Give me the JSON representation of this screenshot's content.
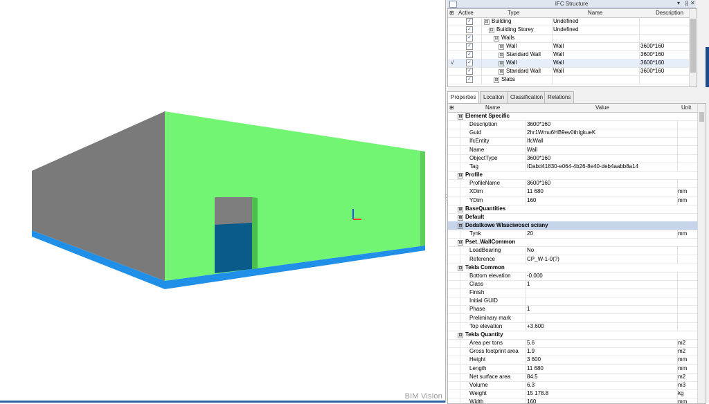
{
  "brand": "BIM Vision",
  "colors": {
    "wall_front": "#72f572",
    "wall_side": "#7a7a7a",
    "slab": "#1f8fe8",
    "door": "#0a5a8a",
    "selection_row": "#c6d4e9",
    "accent": "#1c4b8c"
  },
  "structure": {
    "title": "IFC Structure",
    "controls": [
      "▾",
      "ㅐ",
      "✕"
    ],
    "columns": [
      "Active",
      "Type",
      "Name",
      "Description"
    ],
    "rows": [
      {
        "marker": "",
        "checked": "✓",
        "indent": 0,
        "expander": "⊟",
        "type": "Building",
        "name": "Undefined",
        "desc": ""
      },
      {
        "marker": "",
        "checked": "✓",
        "indent": 1,
        "expander": "⊟",
        "type": "Building Storey",
        "name": "Undefined",
        "desc": ""
      },
      {
        "marker": "",
        "checked": "✓",
        "indent": 2,
        "expander": "⊟",
        "type": "Walls",
        "name": "",
        "desc": ""
      },
      {
        "marker": "",
        "checked": "✓",
        "indent": 3,
        "expander": "⊞",
        "type": "Wall",
        "name": "Wall",
        "desc": "3600*160"
      },
      {
        "marker": "",
        "checked": "✓",
        "indent": 3,
        "expander": "⊞",
        "type": "Standard Wall",
        "name": "Wall",
        "desc": "3600*160"
      },
      {
        "marker": "√",
        "checked": "✓",
        "indent": 3,
        "expander": "⊞",
        "type": "Wall",
        "name": "Wall",
        "desc": "3600*160"
      },
      {
        "marker": "",
        "checked": "✓",
        "indent": 3,
        "expander": "⊞",
        "type": "Standard Wall",
        "name": "Wall",
        "desc": "3600*160"
      },
      {
        "marker": "",
        "checked": "✓",
        "indent": 2,
        "expander": "⊞",
        "type": "Slabs",
        "name": "",
        "desc": ""
      }
    ]
  },
  "tabs": [
    "Properties",
    "Location",
    "Classification",
    "Relations"
  ],
  "properties": {
    "columns": [
      "Name",
      "Value",
      "Unit"
    ],
    "rows": [
      {
        "cat": true,
        "hl": false,
        "exp": "⊟",
        "name": "Element Specific",
        "value": "",
        "unit": ""
      },
      {
        "cat": false,
        "name": "Description",
        "value": "3600*160",
        "unit": ""
      },
      {
        "cat": false,
        "name": "Guid",
        "value": "2hr1Wmu6HB9ev0thIgkueK",
        "unit": ""
      },
      {
        "cat": false,
        "name": "IfcEntity",
        "value": "IfcWall",
        "unit": ""
      },
      {
        "cat": false,
        "name": "Name",
        "value": "Wall",
        "unit": ""
      },
      {
        "cat": false,
        "name": "ObjectType",
        "value": "3600*160",
        "unit": ""
      },
      {
        "cat": false,
        "name": "Tag",
        "value": "IDabd41830-e064-4b26-8e40-deb4aabb8a14",
        "unit": ""
      },
      {
        "cat": true,
        "hl": false,
        "exp": "⊟",
        "name": "Profile",
        "value": "",
        "unit": ""
      },
      {
        "cat": false,
        "name": "ProfileName",
        "value": "3600*160",
        "unit": ""
      },
      {
        "cat": false,
        "name": "XDim",
        "value": "11 680",
        "unit": "mm"
      },
      {
        "cat": false,
        "name": "YDim",
        "value": "160",
        "unit": "mm"
      },
      {
        "cat": true,
        "hl": false,
        "exp": "⊞",
        "name": "BaseQuantities",
        "value": "",
        "unit": ""
      },
      {
        "cat": true,
        "hl": false,
        "exp": "⊞",
        "name": "Default",
        "value": "",
        "unit": ""
      },
      {
        "cat": true,
        "hl": true,
        "exp": "⊟",
        "name": "Dodatkowe Wlasciwosci sciany",
        "value": "",
        "unit": ""
      },
      {
        "cat": false,
        "name": "Tynk",
        "value": "20",
        "unit": "mm"
      },
      {
        "cat": true,
        "hl": false,
        "exp": "⊟",
        "name": "Pset_WallCommon",
        "value": "",
        "unit": ""
      },
      {
        "cat": false,
        "name": "LoadBearing",
        "value": "No",
        "unit": ""
      },
      {
        "cat": false,
        "name": "Reference",
        "value": "CP_W-1-0(?)",
        "unit": ""
      },
      {
        "cat": true,
        "hl": false,
        "exp": "⊟",
        "name": "Tekla Common",
        "value": "",
        "unit": ""
      },
      {
        "cat": false,
        "name": "Bottom elevation",
        "value": "-0.000",
        "unit": ""
      },
      {
        "cat": false,
        "name": "Class",
        "value": "1",
        "unit": ""
      },
      {
        "cat": false,
        "name": "Finish",
        "value": "",
        "unit": ""
      },
      {
        "cat": false,
        "name": "Initial GUID",
        "value": "",
        "unit": ""
      },
      {
        "cat": false,
        "name": "Phase",
        "value": "1",
        "unit": ""
      },
      {
        "cat": false,
        "name": "Preliminary mark",
        "value": "",
        "unit": ""
      },
      {
        "cat": false,
        "name": "Top elevation",
        "value": " +3.600",
        "unit": ""
      },
      {
        "cat": true,
        "hl": false,
        "exp": "⊟",
        "name": "Tekla Quantity",
        "value": "",
        "unit": ""
      },
      {
        "cat": false,
        "name": "Area per tons",
        "value": "5.6",
        "unit": "m2"
      },
      {
        "cat": false,
        "name": "Gross footprint area",
        "value": "1.9",
        "unit": "m2"
      },
      {
        "cat": false,
        "name": "Height",
        "value": "3 600",
        "unit": "mm"
      },
      {
        "cat": false,
        "name": "Length",
        "value": "11 680",
        "unit": "mm"
      },
      {
        "cat": false,
        "name": "Net surface area",
        "value": "84.5",
        "unit": "m2"
      },
      {
        "cat": false,
        "name": "Volume",
        "value": "6.3",
        "unit": "m3"
      },
      {
        "cat": false,
        "name": "Weight",
        "value": "15 178.8",
        "unit": "kg"
      },
      {
        "cat": false,
        "name": "Width",
        "value": "160",
        "unit": "mm"
      }
    ]
  }
}
